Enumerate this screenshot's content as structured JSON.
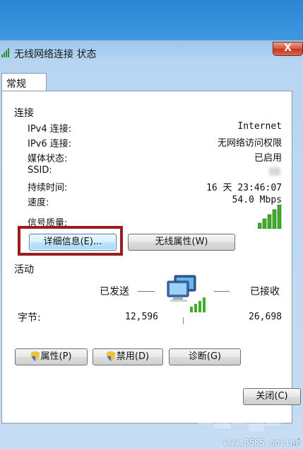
{
  "window": {
    "title": "无线网络连接 状态",
    "close_label": "X"
  },
  "tabs": [
    {
      "label": "常规"
    }
  ],
  "connection": {
    "section_label": "连接",
    "rows": [
      {
        "label": "IPv4 连接:",
        "value": "Internet"
      },
      {
        "label": "IPv6 连接:",
        "value": "无网络访问权限"
      },
      {
        "label": "媒体状态:",
        "value": "已启用"
      },
      {
        "label": "SSID:",
        "value": ""
      },
      {
        "label": "持续时间:",
        "value": "16 天 23:46:07"
      },
      {
        "label": "速度:",
        "value": "54.0 Mbps"
      }
    ],
    "signal_label": "信号质量:",
    "signal_bars": 5,
    "details_button": "详细信息(E)...",
    "wireless_props_button": "无线属性(W)"
  },
  "activity": {
    "section_label": "活动",
    "sent_label": "已发送",
    "received_label": "已接收",
    "bytes_label": "字节:",
    "bytes_sent": "12,596",
    "bytes_received": "26,698"
  },
  "actions": {
    "properties_button": "属性(P)",
    "disable_button": "禁用(D)",
    "diagnose_button": "诊断(G)"
  },
  "footer": {
    "close_button": "关闭(C)"
  },
  "watermark": "www.8585.online",
  "colors": {
    "highlight_box": "#9b1c1c",
    "signal_green": "#3fae2a",
    "titlebar_blue": "#9cc6ec"
  }
}
